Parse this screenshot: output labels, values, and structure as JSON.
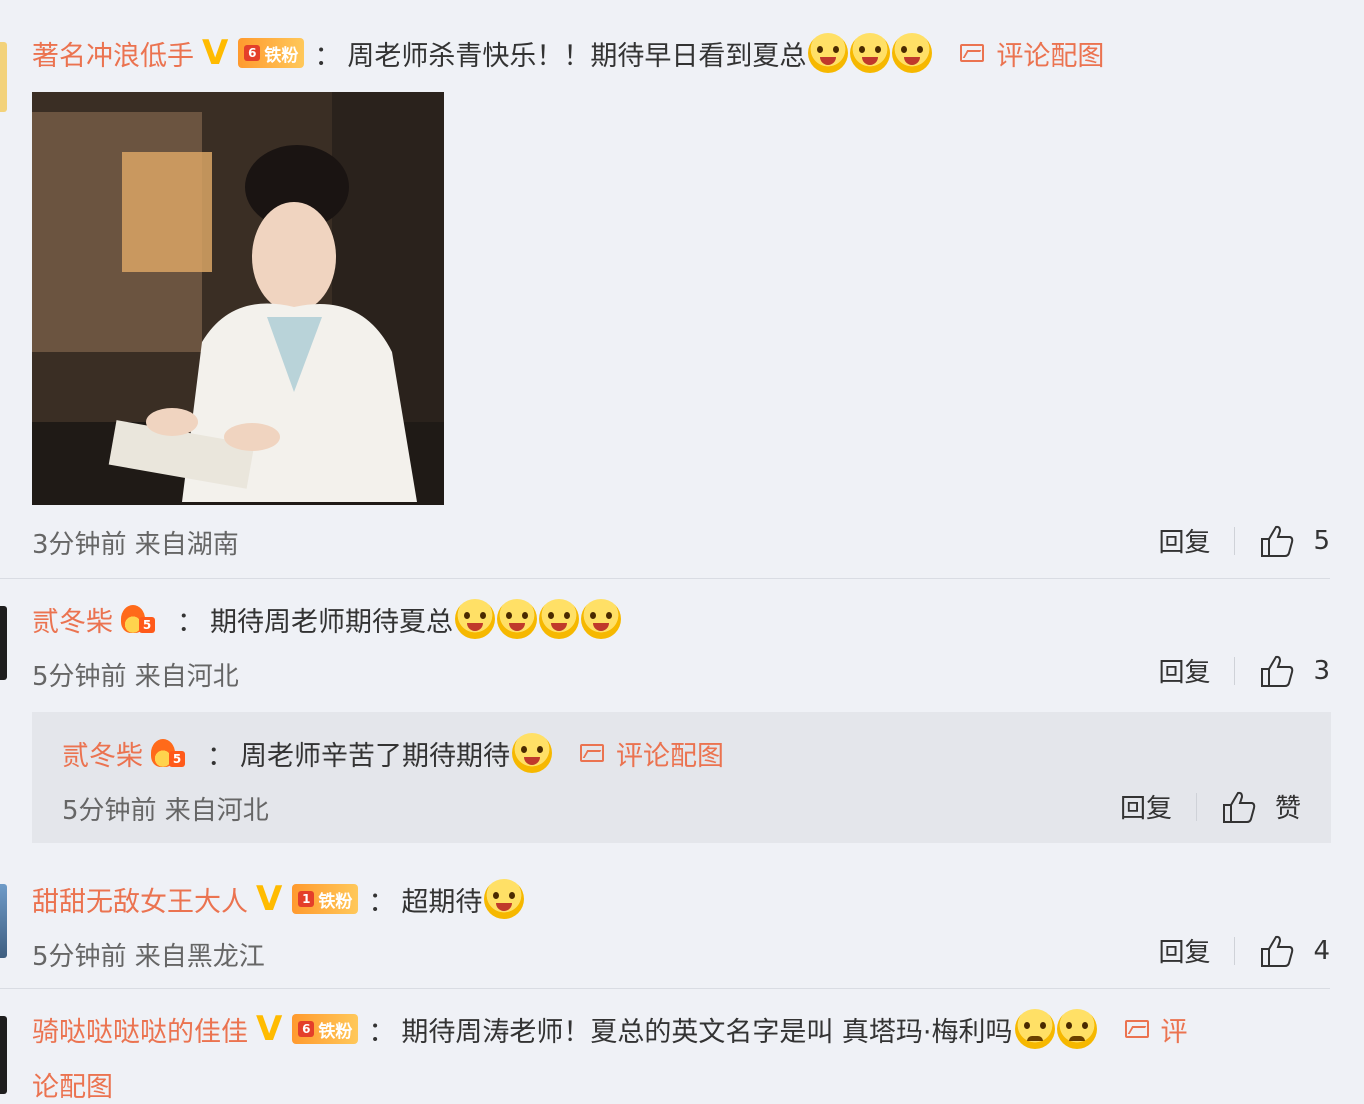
{
  "comments": [
    {
      "username": "著名冲浪低手",
      "verified": "V",
      "fan_badge": "铁粉",
      "fan_level": "6",
      "text": "周老师杀青快乐！！期待早日看到夏总",
      "image_link": "评论配图",
      "meta": "3分钟前 来自湖南",
      "reply_label": "回复",
      "likes": "5"
    },
    {
      "username": "贰冬柴",
      "fan_level": "5",
      "text": "期待周老师期待夏总",
      "meta": "5分钟前 来自河北",
      "reply_label": "回复",
      "likes": "3",
      "sub_reply": {
        "username": "贰冬柴",
        "fan_level": "5",
        "text": "周老师辛苦了期待期待",
        "image_link": "评论配图",
        "meta": "5分钟前 来自河北",
        "reply_label": "回复",
        "like_label": "赞"
      }
    },
    {
      "username": "甜甜无敌女王大人",
      "verified": "V",
      "fan_badge": "铁粉",
      "fan_level": "1",
      "text": "超期待",
      "meta": "5分钟前 来自黑龙江",
      "reply_label": "回复",
      "likes": "4"
    },
    {
      "username": "骑哒哒哒哒的佳佳",
      "verified": "V",
      "fan_badge": "铁粉",
      "fan_level": "6",
      "text": "期待周涛老师！夏总的英文名字是叫 真塔玛·梅利吗",
      "image_link_part1": "评",
      "image_link_part2": "论配图"
    }
  ],
  "colon": "：",
  "colors": {
    "username": "#eb7350",
    "fan_badge": "#ffb340",
    "verified": "#ffbb00",
    "background": "#eff1f6"
  }
}
